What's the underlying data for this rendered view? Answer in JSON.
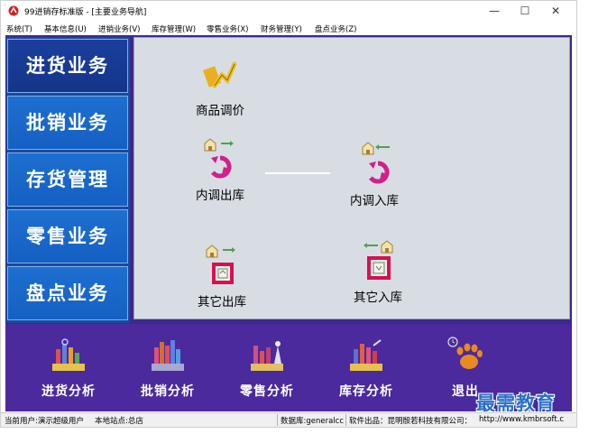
{
  "window": {
    "title": "99进销存标准版 - [主要业务导航]",
    "minimize": "—",
    "maximize": "☐",
    "close": "✕"
  },
  "menubar": {
    "items": [
      "系统(T)",
      "基本信息(U)",
      "进销业务(V)",
      "库存管理(W)",
      "零售业务(X)",
      "财务管理(Y)",
      "盘点业务(Z)"
    ]
  },
  "left_nav": {
    "items": [
      "进货业务",
      "批销业务",
      "存货管理",
      "零售业务",
      "盘点业务"
    ],
    "active": "进货业务"
  },
  "workspace": {
    "items": [
      {
        "label": "商品调价",
        "icon": "price-adjust-icon"
      },
      {
        "label": "内调出库",
        "icon": "internal-out-icon"
      },
      {
        "label": "内调入库",
        "icon": "internal-in-icon"
      },
      {
        "label": "其它出库",
        "icon": "other-out-icon"
      },
      {
        "label": "其它入库",
        "icon": "other-in-icon"
      }
    ]
  },
  "bottom_bar": {
    "items": [
      {
        "label": "进货分析",
        "icon": "purchase-analysis-icon"
      },
      {
        "label": "批销分析",
        "icon": "wholesale-analysis-icon"
      },
      {
        "label": "零售分析",
        "icon": "retail-analysis-icon"
      },
      {
        "label": "库存分析",
        "icon": "inventory-analysis-icon"
      },
      {
        "label": "退出",
        "icon": "exit-icon"
      }
    ]
  },
  "statusbar": {
    "user": "当前用户:演示超级用户",
    "site": "本地站点:总店",
    "database": "数据库:generalcc",
    "vendor": "软件出品：昆明殷若科技有限公司：",
    "url": "http://www.kmbrsoft.c"
  },
  "watermark": "最需教育",
  "colors": {
    "nav_blue": "#1560c3",
    "nav_active": "#14358a",
    "bottom_purple": "#4a2a9c",
    "workspace_gray": "#d8dde4"
  }
}
